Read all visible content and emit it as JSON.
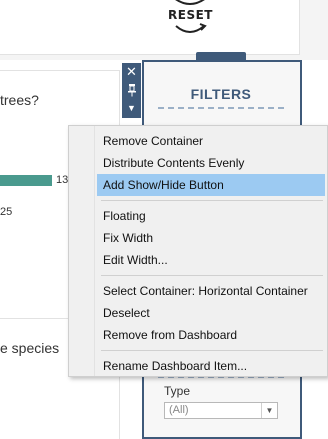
{
  "reset": {
    "label": "RESET"
  },
  "chart": {
    "question": "trees?",
    "bar_label_1": "13",
    "bar_label_2": "25",
    "bar_color": "#4a9a8e"
  },
  "lower": {
    "text": "e species"
  },
  "filters": {
    "title": "FILTERS",
    "type_label": "Type",
    "type_value": "(All)",
    "accent": "#3f5a7a"
  },
  "container_controls": {
    "close_icon": "close-icon",
    "pin_icon": "pin-icon",
    "menu_icon": "dropdown-arrow-icon"
  },
  "context_menu": {
    "items": [
      {
        "label": "Remove Container"
      },
      {
        "label": "Distribute Contents Evenly"
      },
      {
        "label": "Add Show/Hide Button",
        "highlighted": true
      },
      {
        "label": "Floating"
      },
      {
        "label": "Fix Width"
      },
      {
        "label": "Edit Width..."
      },
      {
        "label": "Select Container: Horizontal Container"
      },
      {
        "label": "Deselect"
      },
      {
        "label": "Remove from Dashboard"
      },
      {
        "label": "Rename Dashboard Item..."
      }
    ],
    "highlight_color": "#9ccaf2"
  }
}
